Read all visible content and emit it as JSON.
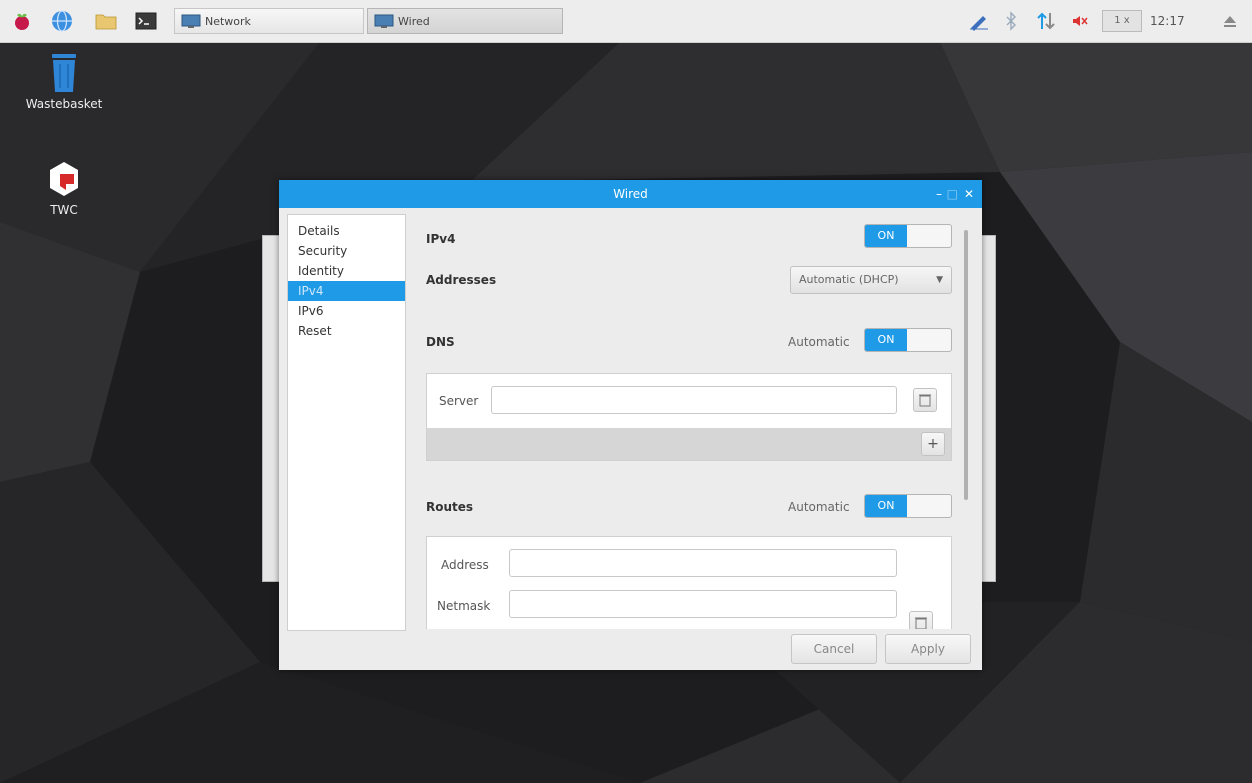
{
  "panel": {
    "taskbar": [
      {
        "label": "Network",
        "active": false
      },
      {
        "label": "Wired",
        "active": true
      }
    ],
    "clock": "12:17",
    "lang": "1 x"
  },
  "desktop": {
    "icons": [
      {
        "label": "Wastebasket"
      },
      {
        "label": "TWC"
      }
    ]
  },
  "dialog": {
    "title": "Wired",
    "sidebar": [
      "Details",
      "Security",
      "Identity",
      "IPv4",
      "IPv6",
      "Reset"
    ],
    "selected": "IPv4",
    "ipv4": {
      "label": "IPv4",
      "toggle": "ON",
      "addresses_label": "Addresses",
      "addresses_value": "Automatic (DHCP)",
      "dns_label": "DNS",
      "dns_auto": "Automatic",
      "dns_toggle": "ON",
      "server_label": "Server",
      "server_value": "",
      "add_symbol": "+",
      "routes_label": "Routes",
      "routes_auto": "Automatic",
      "routes_toggle": "ON",
      "address_label": "Address",
      "netmask_label": "Netmask"
    },
    "buttons": {
      "cancel": "Cancel",
      "apply": "Apply"
    }
  },
  "colors": {
    "accent": "#1e9ae6",
    "panel": "#ededed",
    "dialog_bg": "#ececec"
  }
}
